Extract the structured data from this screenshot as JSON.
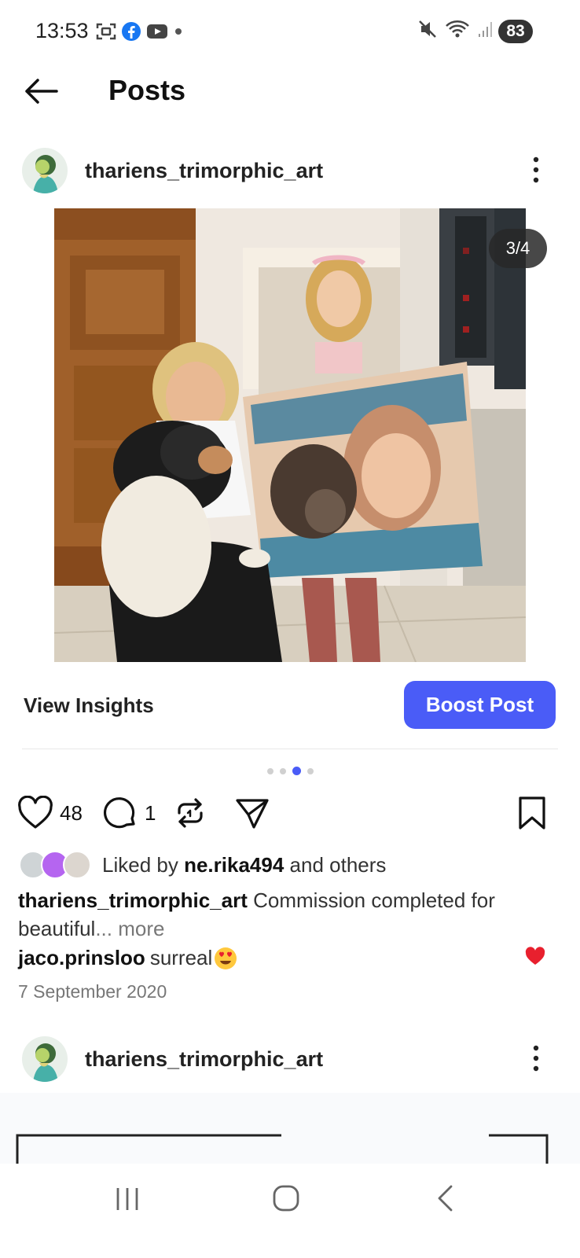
{
  "status_bar": {
    "time": "13:53",
    "battery": "83"
  },
  "app_bar": {
    "title": "Posts"
  },
  "post": {
    "username": "thariens_trimorphic_art",
    "image_counter": "3/4",
    "view_insights_label": "View Insights",
    "boost_label": "Boost Post",
    "carousel": {
      "count": 4,
      "active_index": 2
    },
    "likes_count": "48",
    "comments_count": "1",
    "liked_by": {
      "prefix": "Liked by",
      "user": "ne.rika494",
      "suffix": "and others"
    },
    "caption": {
      "username": "thariens_trimorphic_art",
      "text": "Commission completed for beautiful",
      "more": "... more"
    },
    "comment": {
      "username": "jaco.prinsloo",
      "text": "surreal"
    },
    "date": "7 September 2020"
  },
  "next_post": {
    "username": "thariens_trimorphic_art"
  },
  "icons": {
    "status_left": [
      "screenshot-icon",
      "facebook-icon",
      "youtube-icon"
    ],
    "status_right": [
      "mute-icon",
      "wifi-icon",
      "signal-icon"
    ],
    "actions": [
      "heart-icon",
      "comment-icon",
      "repost-icon",
      "share-icon",
      "bookmark-icon"
    ],
    "nav": [
      "recent-apps-icon",
      "home-icon",
      "back-icon"
    ]
  },
  "colors": {
    "accent": "#4a5cf7",
    "like_red": "#e8202e"
  }
}
